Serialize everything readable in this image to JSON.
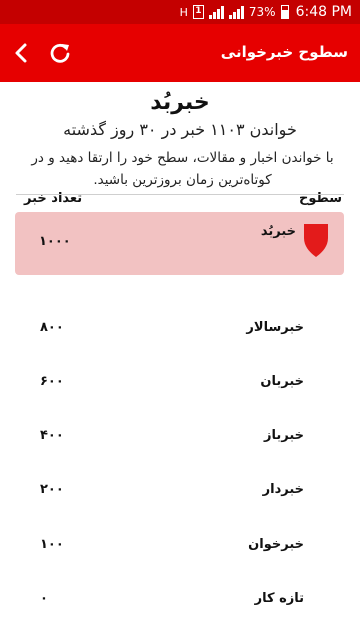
{
  "status_bar": {
    "sim_icon": "H",
    "notification_badge": "1",
    "battery": "73%",
    "time": "6:48 PM",
    "accent": "#c40000"
  },
  "app_bar": {
    "title": "سطوح خبرخوانی",
    "back_icon": "chevron-left-icon",
    "refresh_icon": "refresh-icon",
    "color": "#e60000"
  },
  "current": {
    "title": "خبربُد",
    "read_count": "خواندن ۱۱۰۳ خبر در ۳۰ روز گذشته",
    "description": "با خواندن اخبار و مقالات، سطح خود را ارتقا دهید و در کوتاه‌ترین زمان بروزترین باشید."
  },
  "table": {
    "header_levels": "سطوح",
    "header_count": "تعداد خبر",
    "highlight_color": "#f2c2c2",
    "badge_color": "#e31b1b",
    "rows": [
      {
        "name": "خبربُد",
        "count": "۱۰۰۰",
        "current": true
      },
      {
        "name": "خبرسالار",
        "count": "۸۰۰"
      },
      {
        "name": "خبربان",
        "count": "۶۰۰"
      },
      {
        "name": "خبرباز",
        "count": "۴۰۰"
      },
      {
        "name": "خبردار",
        "count": "۲۰۰"
      },
      {
        "name": "خبرخوان",
        "count": "۱۰۰"
      },
      {
        "name": "تازه کار",
        "count": "۰"
      }
    ]
  }
}
